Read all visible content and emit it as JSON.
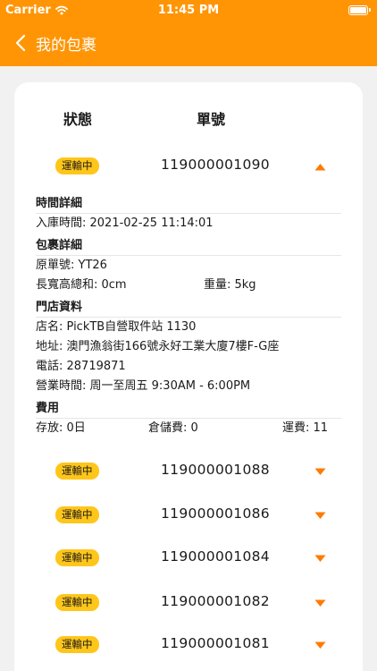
{
  "status_bar": {
    "carrier": "Carrier",
    "time": "11:45 PM"
  },
  "nav": {
    "title": "我的包裹"
  },
  "table": {
    "col_status": "狀態",
    "col_number": "單號"
  },
  "expanded": {
    "status": "運輸中",
    "number": "119000001090",
    "time_section": "時間詳細",
    "inbound_time": "入庫時間: 2021-02-25 11:14:01",
    "parcel_section": "包裹詳細",
    "original_no": "原單號: YT26",
    "dimensions": "長寬高總和: 0cm",
    "weight": "重量: 5kg",
    "store_section": "門店資料",
    "store_name": "店名: PickTB自營取件站 1130",
    "address": "地址: 澳門漁翁街166號永好工業大廈7樓F-G座",
    "phone": "電話: 28719871",
    "hours": "營業時間: 周一至周五 9:30AM - 6:00PM",
    "fee_section": "費用",
    "fee_storage": "存放: 0日",
    "fee_warehouse": "倉儲費: 0",
    "fee_shipping": "運費: 11"
  },
  "parcels": [
    {
      "status": "運輸中",
      "number": "119000001088"
    },
    {
      "status": "運輸中",
      "number": "119000001086"
    },
    {
      "status": "運輸中",
      "number": "119000001084"
    },
    {
      "status": "運輸中",
      "number": "119000001082"
    },
    {
      "status": "運輸中",
      "number": "119000001081"
    }
  ],
  "colors": {
    "accent": "#ff9505",
    "badge": "#ffc61a",
    "arrow": "#ff7a00"
  },
  "icons": {
    "back": "chevron-left-icon",
    "expand": "caret-down-icon",
    "collapse": "caret-up-icon"
  }
}
